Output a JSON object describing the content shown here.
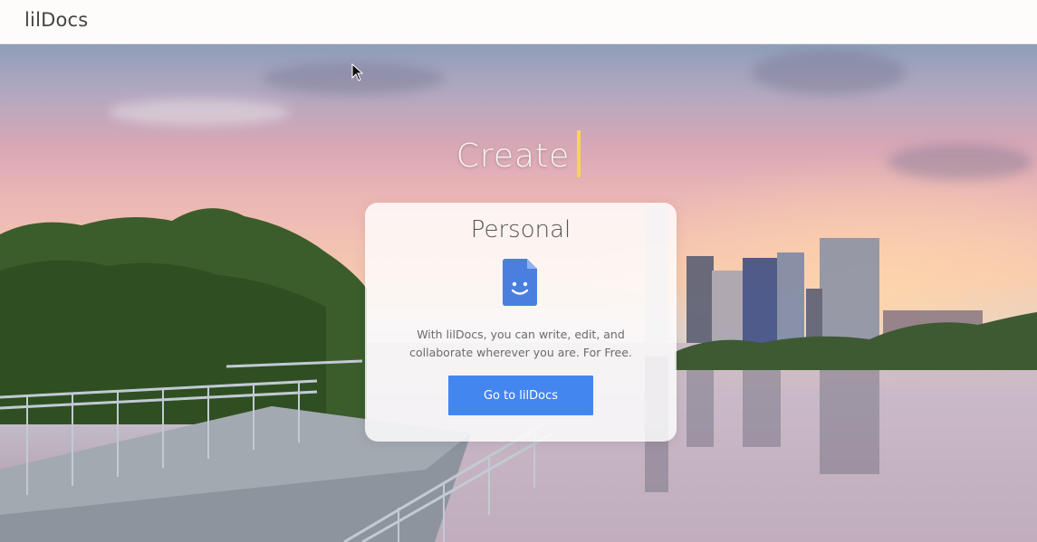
{
  "app": {
    "brand": "lilDocs"
  },
  "hero": {
    "headline": "Create"
  },
  "card": {
    "title": "Personal",
    "icon": "document-smile-icon",
    "description": "With lilDocs, you can write, edit, and collaborate wherever you are. For Free.",
    "button_label": "Go to lilDocs"
  },
  "colors": {
    "accent_button": "#4486f0",
    "cursor_bar": "#f7d35a",
    "icon_blue": "#4a7fe0"
  }
}
